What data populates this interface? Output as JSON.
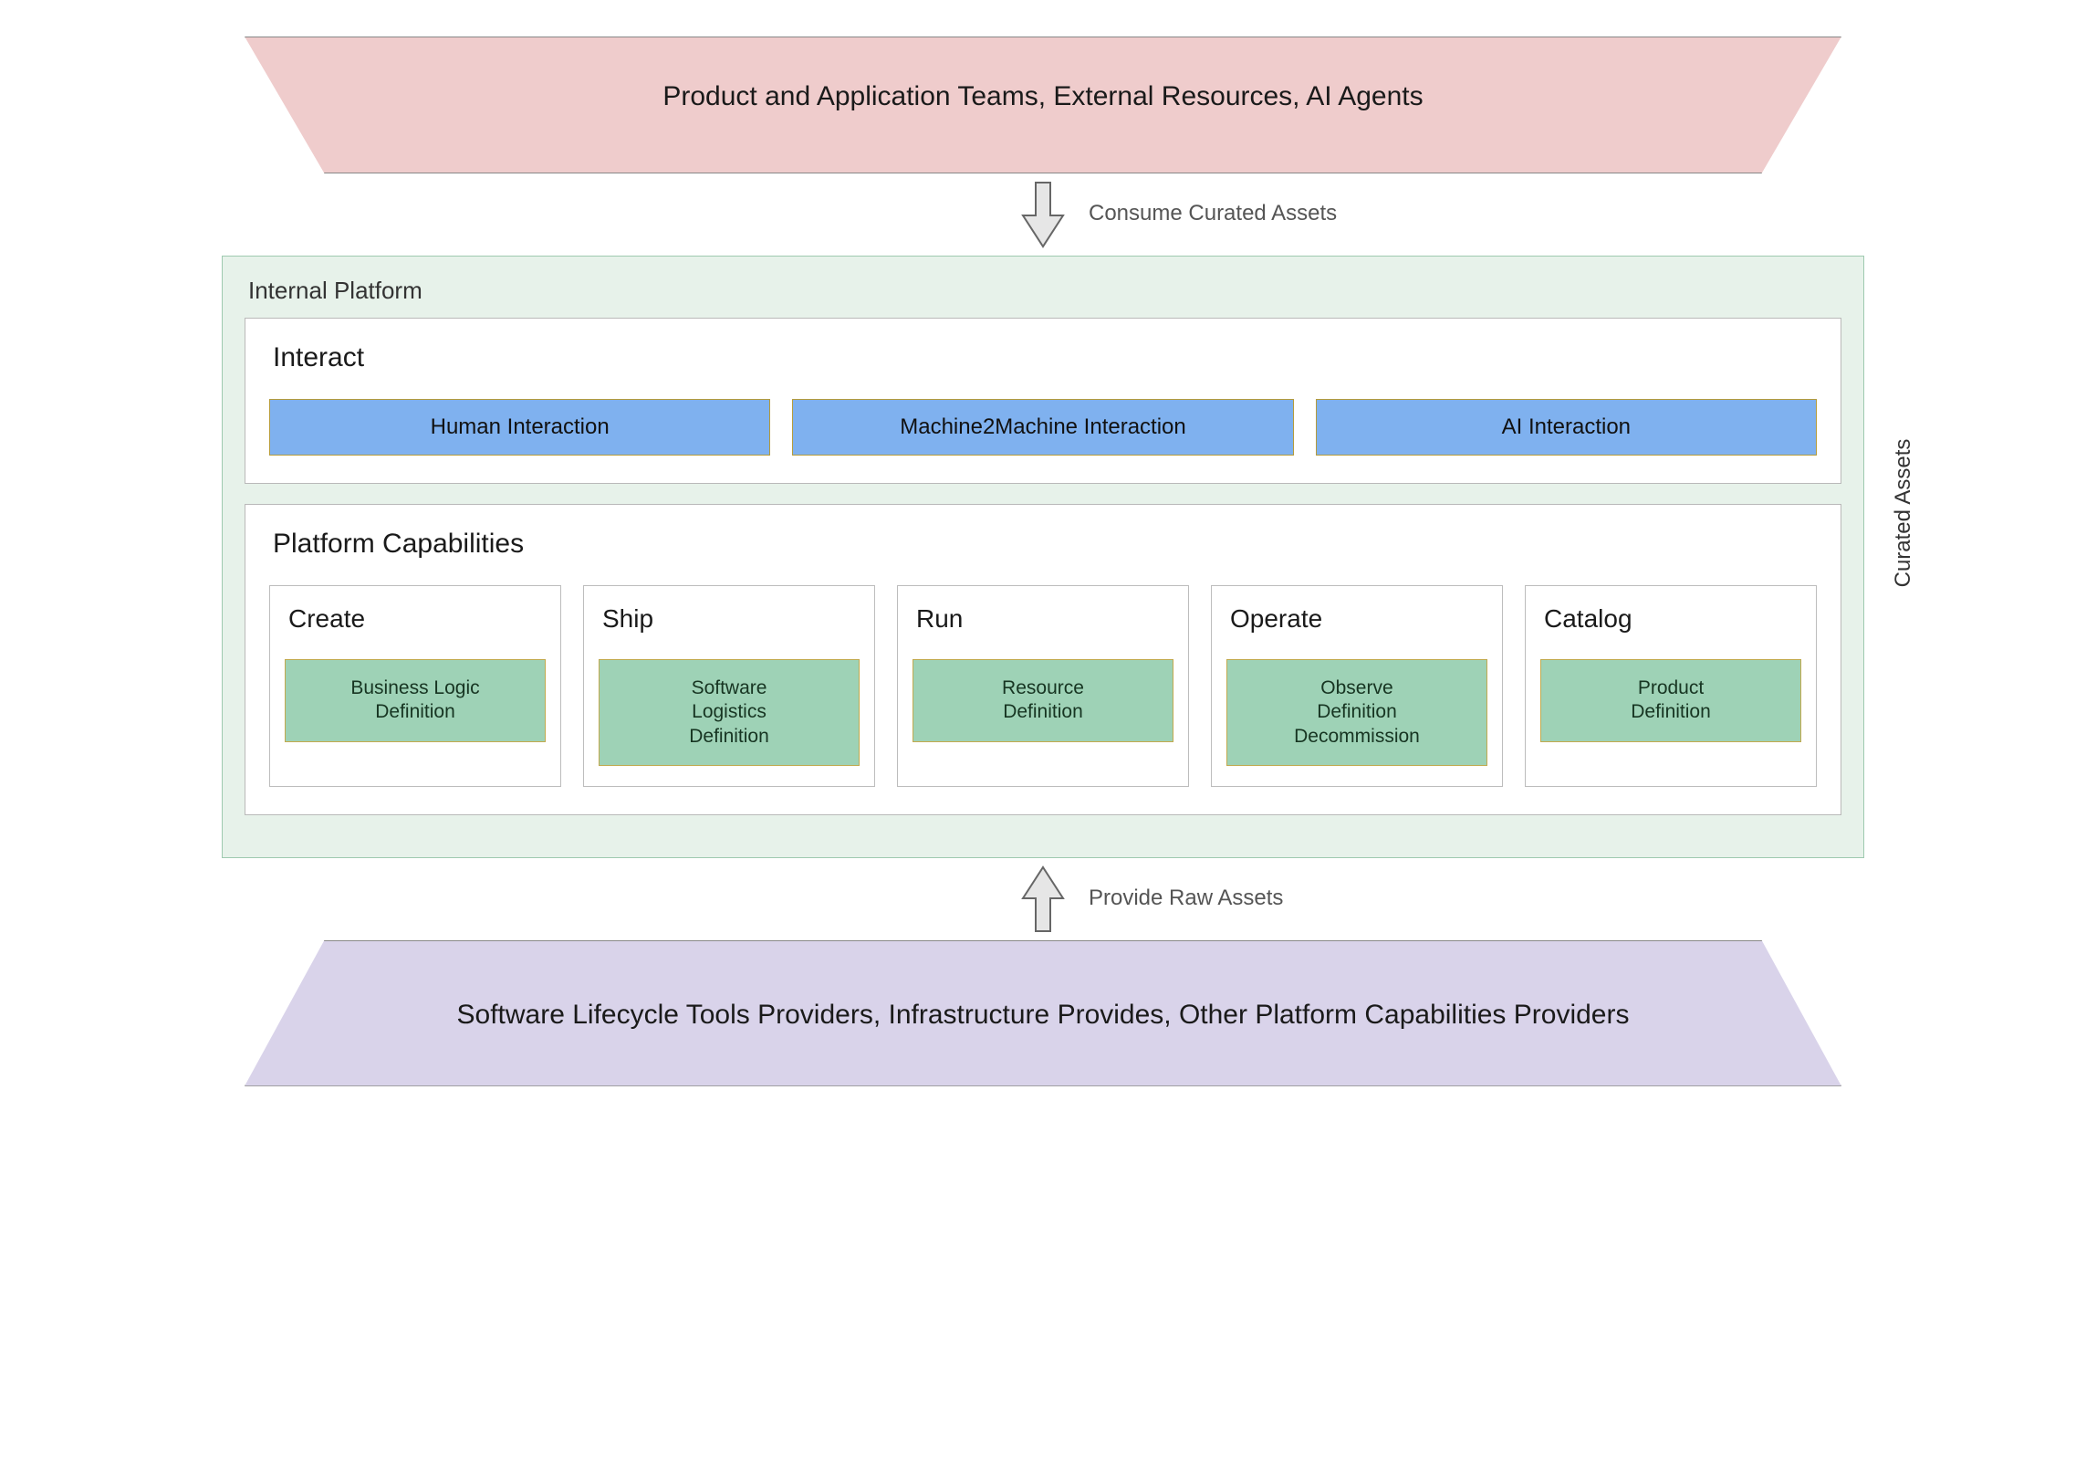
{
  "top_band": {
    "label": "Product and Application Teams, External Resources, AI Agents"
  },
  "arrows": {
    "consume_label": "Consume Curated Assets",
    "provide_label": "Provide Raw Assets"
  },
  "platform": {
    "title": "Internal Platform",
    "curated_label": "Curated Assets",
    "interact": {
      "title": "Interact",
      "items": [
        {
          "label": "Human Interaction"
        },
        {
          "label": "Machine2Machine Interaction"
        },
        {
          "label": "AI Interaction"
        }
      ]
    },
    "capabilities": {
      "title": "Platform Capabilities",
      "items": [
        {
          "title": "Create",
          "definition": "Business Logic\nDefinition"
        },
        {
          "title": "Ship",
          "definition": "Software\nLogistics\nDefinition"
        },
        {
          "title": "Run",
          "definition": "Resource\nDefinition"
        },
        {
          "title": "Operate",
          "definition": "Observe\nDefinition\nDecommission"
        },
        {
          "title": "Catalog",
          "definition": "Product\nDefinition"
        }
      ]
    }
  },
  "bottom_band": {
    "label": "Software Lifecycle Tools Providers, Infrastructure Provides, Other Platform Capabilities Providers"
  }
}
